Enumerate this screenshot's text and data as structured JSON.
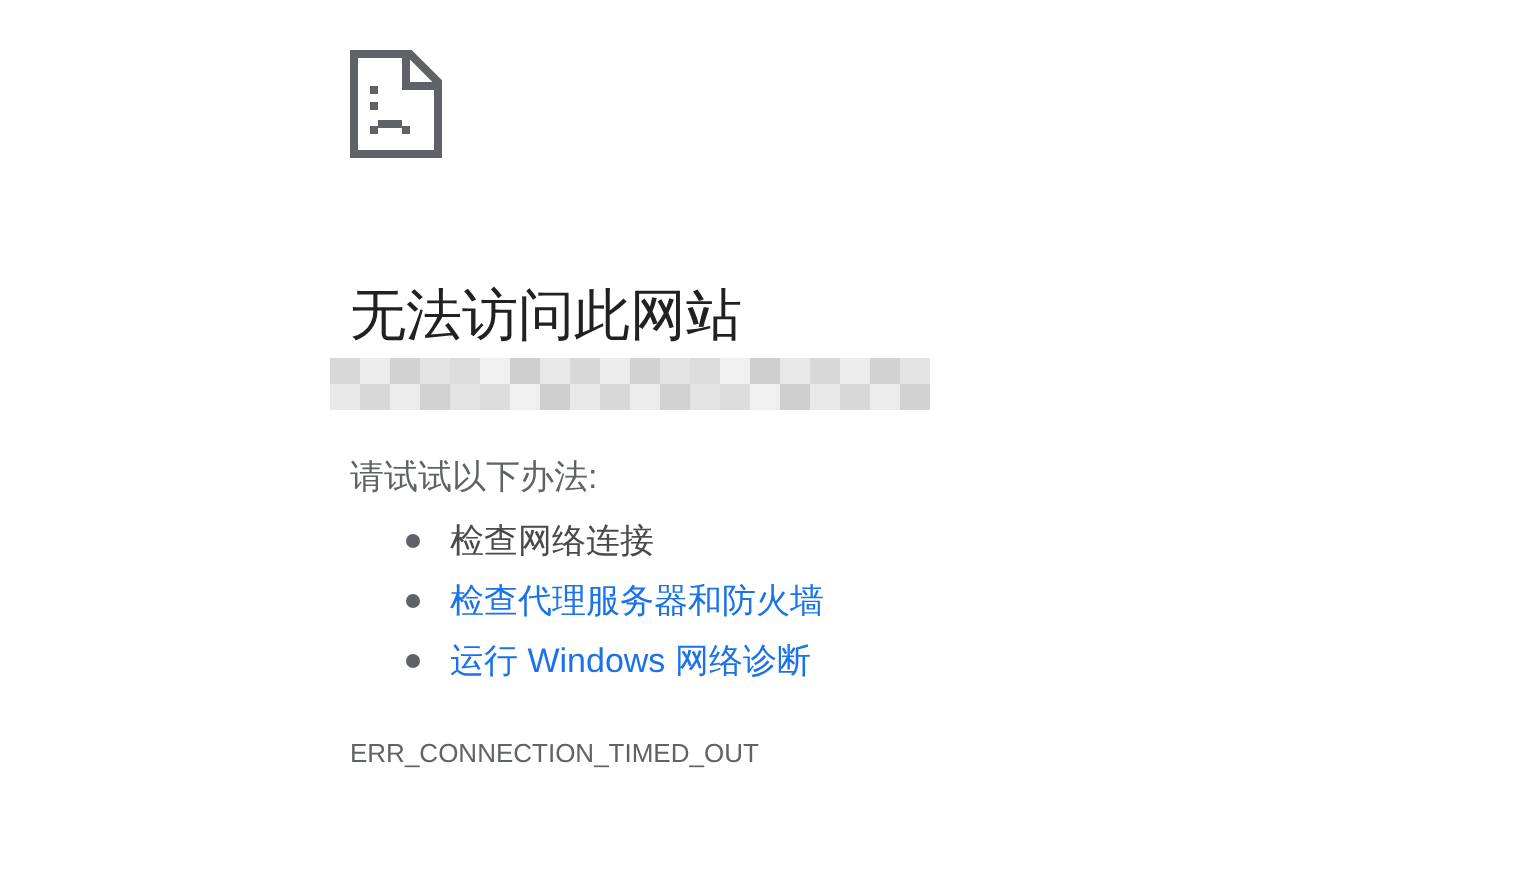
{
  "heading": "无法访问此网站",
  "suggestions_intro": "请试试以下办法:",
  "suggestions": [
    {
      "kind": "text",
      "label": "检查网络连接"
    },
    {
      "kind": "link",
      "label": "检查代理服务器和防火墙"
    },
    {
      "kind": "link",
      "label": "运行 Windows 网络诊断"
    }
  ],
  "error_code": "ERR_CONNECTION_TIMED_OUT"
}
